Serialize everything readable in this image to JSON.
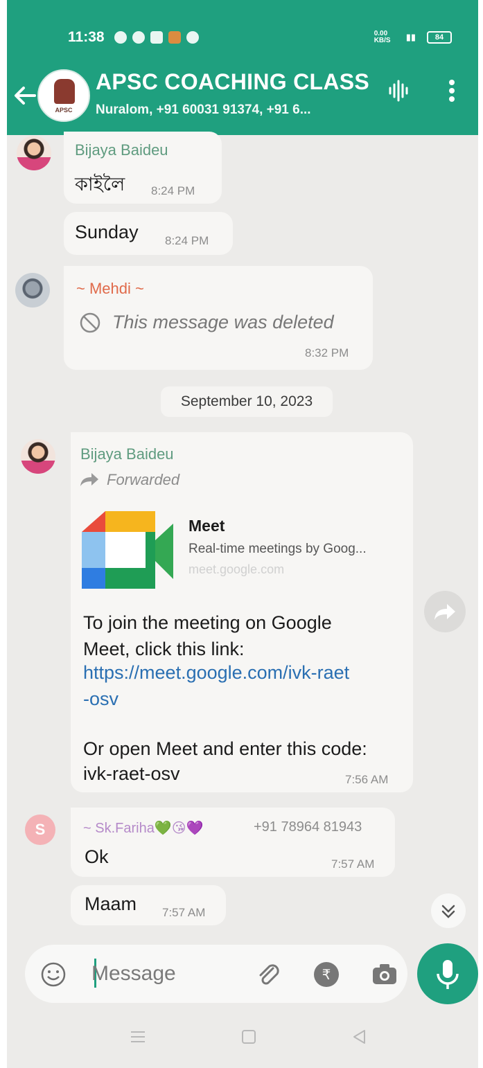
{
  "status_bar": {
    "time": "11:38",
    "network_speed": "0.00 KB/S",
    "battery": "84"
  },
  "header": {
    "back_icon": "arrow-left-icon",
    "group_avatar_label": "APSC",
    "title": "APSC COACHING CLASS",
    "subtitle": "Nuralom, +91 60031 91374, +91 6...",
    "voice_icon": "voice-waveform-icon",
    "menu_icon": "more-vertical-icon"
  },
  "messages": [
    {
      "sender": "Bijaya Baideu",
      "text": "কাইলৈ",
      "time": "8:24 PM"
    },
    {
      "sender": "",
      "text": "Sunday",
      "time": "8:24 PM"
    },
    {
      "sender": "~ Mehdi ~",
      "text": "This message was deleted",
      "time": "8:32 PM",
      "deleted": true
    },
    {
      "sender": "Bijaya Baideu",
      "forwarded_label": "Forwarded",
      "preview": {
        "title": "Meet",
        "description": "Real-time meetings by Goog...",
        "domain": "meet.google.com"
      },
      "text_line1": "To join the meeting on Google",
      "text_line2": "Meet, click this link:",
      "link_line1": "https://meet.google.com/ivk-raet",
      "link_line2": "-osv",
      "text_line3": "Or open Meet and enter this code:",
      "text_line4": "ivk-raet-osv",
      "time": "7:56 AM"
    },
    {
      "sender": "~ Sk.Fariha💚😘💜",
      "sender_phone": "+91 78964 81943",
      "avatar_letter": "S",
      "text": "Ok",
      "time": "7:57 AM"
    },
    {
      "sender": "",
      "text": "Maam",
      "time": "7:57 AM"
    }
  ],
  "date_divider": "September 10, 2023",
  "composer": {
    "placeholder": "Message"
  },
  "colors": {
    "header": "#1fa07f",
    "link": "#2a6fb2",
    "sender_bijaya": "#5f9b7f",
    "sender_mehdi": "#e06a4a",
    "sender_fariha": "#b58ac9"
  }
}
